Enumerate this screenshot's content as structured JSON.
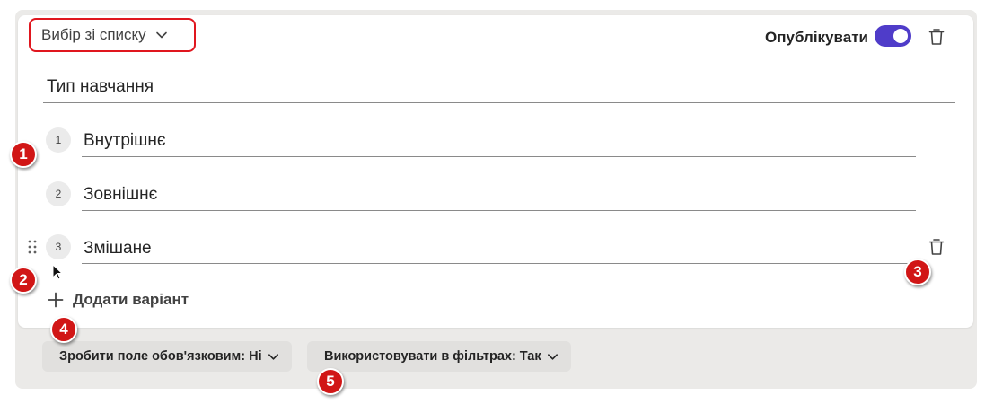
{
  "question": {
    "type_dropdown": "Вибір зі списку",
    "publish_label": "Опублікувати",
    "publish_on": true,
    "title": "Тип навчання"
  },
  "options": [
    {
      "number": "1",
      "text": "Внутрішнє"
    },
    {
      "number": "2",
      "text": "Зовнішнє"
    },
    {
      "number": "3",
      "text": "Змішане"
    }
  ],
  "add_option_label": "Додати варіант",
  "footer": {
    "required_label": "Зробити поле обов'язковим: Ні",
    "filter_label": "Використовувати в фільтрах: Так"
  },
  "badges": [
    "1",
    "2",
    "3",
    "4",
    "5"
  ],
  "colors": {
    "accent": "#4f3cc9",
    "badge": "#d11616",
    "highlight_border": "#e0161e"
  }
}
